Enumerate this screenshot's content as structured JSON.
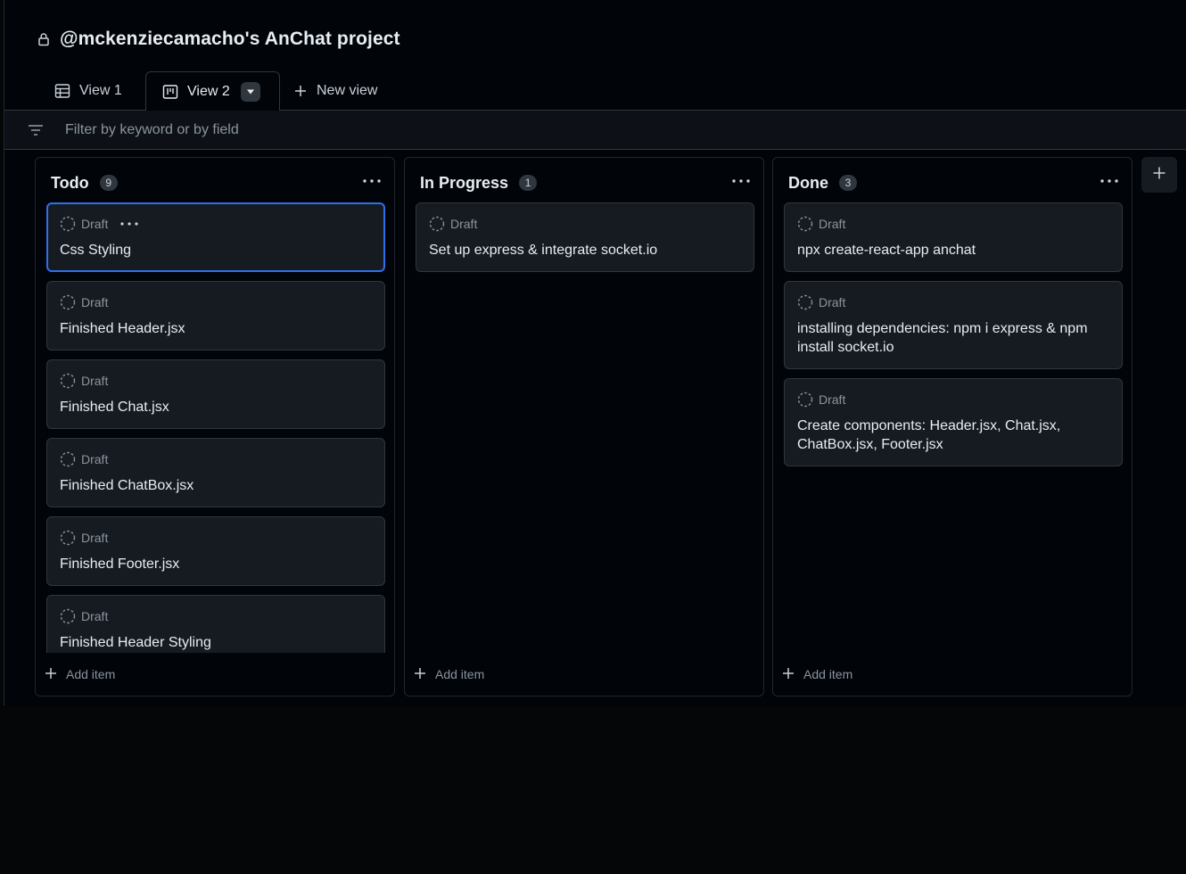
{
  "project": {
    "title": "@mckenziecamacho's AnChat project"
  },
  "tabs": [
    {
      "label": "View 1"
    },
    {
      "label": "View 2"
    },
    {
      "label": "New view"
    }
  ],
  "filter": {
    "placeholder": "Filter by keyword or by field"
  },
  "columns": [
    {
      "title": "Todo",
      "count": "9",
      "add_label": "Add item",
      "cards": [
        {
          "status": "Draft",
          "title": "Css Styling"
        },
        {
          "status": "Draft",
          "title": "Finished Header.jsx"
        },
        {
          "status": "Draft",
          "title": "Finished Chat.jsx"
        },
        {
          "status": "Draft",
          "title": "Finished ChatBox.jsx"
        },
        {
          "status": "Draft",
          "title": "Finished Footer.jsx"
        },
        {
          "status": "Draft",
          "title": "Finished Header Styling"
        }
      ]
    },
    {
      "title": "In Progress",
      "count": "1",
      "add_label": "Add item",
      "cards": [
        {
          "status": "Draft",
          "title": "Set up express & integrate socket.io"
        }
      ]
    },
    {
      "title": "Done",
      "count": "3",
      "add_label": "Add item",
      "cards": [
        {
          "status": "Draft",
          "title": "npx create-react-app anchat"
        },
        {
          "status": "Draft",
          "title": "installing dependencies: npm i express & npm install socket.io"
        },
        {
          "status": "Draft",
          "title": "Create components: Header.jsx, Chat.jsx, ChatBox.jsx, Footer.jsx"
        }
      ]
    }
  ],
  "colors": {
    "background": "#010409",
    "card": "#161b22",
    "border": "#30363d",
    "selected": "#2f6feb",
    "muted": "#8b949e"
  }
}
